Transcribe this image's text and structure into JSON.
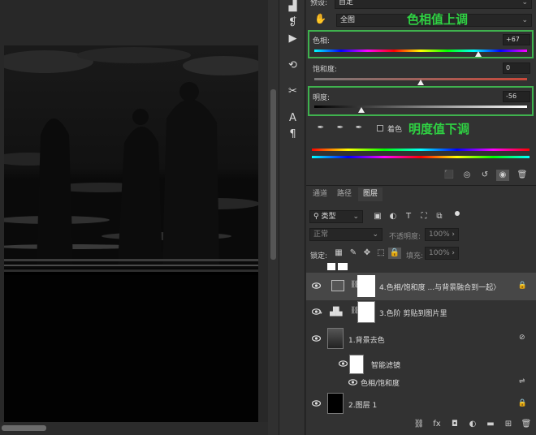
{
  "header": {
    "preset_label": "预设:",
    "preset_value": "自定",
    "channel_value": "全图"
  },
  "hue_sat": {
    "hue_label": "色相:",
    "hue_value": "+67",
    "hue_level": 0.77,
    "saturation_label": "饱和度:",
    "saturation_value": "0",
    "saturation_level": 0.5,
    "lightness_label": "明度:",
    "lightness_value": "-56",
    "lightness_level": 0.22,
    "colorize_label": "着色"
  },
  "annotations": {
    "hue_note": "色相值上调",
    "lightness_note": "明度值下调"
  },
  "tabs": [
    "通道",
    "路径",
    "图层"
  ],
  "layers_panel": {
    "filter_kind": "类型",
    "blend_mode": "正常",
    "opacity_label": "不透明度:",
    "opacity_value": "100%",
    "lock_label": "锁定:",
    "fill_label": "填充:",
    "fill_value": "100%"
  },
  "layers": [
    {
      "name": "4.色相/饱和度 ...与背景融合到一起〉"
    },
    {
      "name": "3.色阶 剪贴到图片里"
    },
    {
      "name": "1.背景去色"
    },
    {
      "name": "智能滤镜"
    },
    {
      "name": "色相/饱和度"
    },
    {
      "name": "2.图层 1"
    }
  ],
  "colors": {
    "accent_green": "#3fb24e",
    "annotation_green": "#2fd143",
    "panel_bg": "#323232"
  }
}
